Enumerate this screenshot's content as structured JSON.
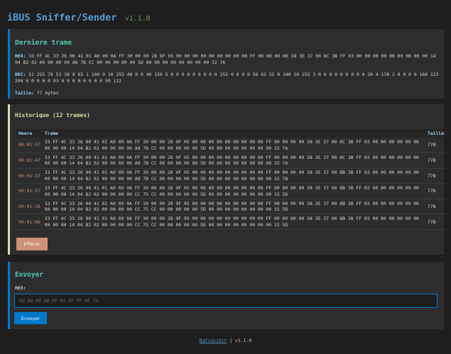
{
  "header": {
    "title": "iBUS Sniffer/Sender",
    "version": "v1.1.0"
  },
  "last_frame": {
    "title": "Derniere trame",
    "hex_label": "HEX:",
    "hex_value": "33 FF 4C 33 26 00 41 01 A0 09 0A FF 30 00 00 28 9F 05 00 00 00 00 00 00 00 00 00 FF 00 00 00 00 38 3E 37 00 8C 3B FF 03 00 00 00 00 00 00 00 00 00 14 04 B2 02 00 00 00 00 A8 7B CC 00 00 00 00 00 5D 00 00 00 00 00 00 00 00 32 7A",
    "dec_label": "DEC:",
    "dec_value": "51 255 76 51 38 0 65 1 160 9 10 255 48 0 0 40 159 5 0 0 0 0 0 0 0 0 0 255 0 0 0 0 56 62 55 0 140 59 255 3 0 0 0 0 0 0 0 0 0 20 4 178 2 0 0 0 0 168 123 204 0 0 0 0 0 93 0 0 0 0 0 0 0 0 50 122",
    "size_label": "Taille:",
    "size_value": "77 bytes"
  },
  "history": {
    "title": "Historique (12 trames)",
    "columns": [
      "Heure",
      "Trame",
      "Taille"
    ],
    "rows": [
      {
        "time": "00:01:57",
        "frame": "33 FF 4C 33 26 00 41 01 A0 09 0A FF 30 00 00 28 9F 05 00 00 00 00 00 00 00 00 00 FF 00 00 00 00 38 3E 37 00 8C 3B FF 03 00 00 00 00 00 00 00 00 00 14 04 B2 02 00 00 00 00 A8 7B CC 00 00 00 00 00 5D 00 00 00 00 00 00 00 00 32 7A",
        "size": "77B"
      },
      {
        "time": "00:01:47",
        "frame": "33 FF 4C 33 26 00 41 01 A0 09 0A FF 30 00 00 28 9F 05 00 00 00 00 00 00 00 00 00 FF 00 00 00 00 38 3E 37 00 8C 3B FF 03 00 00 00 00 00 00 00 00 00 14 04 B2 02 00 00 00 00 A8 7B CC 00 00 00 00 00 5D 00 00 00 00 00 00 00 00 32 7A",
        "size": "77B"
      },
      {
        "time": "00:01:37",
        "frame": "33 FF 4C 33 26 00 41 01 A0 09 0A FF 30 00 00 28 9F 05 00 00 00 00 00 00 00 00 00 FF 00 00 00 00 38 3E 37 00 8B 3B FF 03 00 00 00 00 00 00 00 00 00 14 04 B2 02 00 00 00 00 A8 7B CC 00 00 00 00 00 5D 00 00 00 00 00 00 00 00 32 7B",
        "size": "77B"
      },
      {
        "time": "00:01:27",
        "frame": "33 FF 4C 33 26 00 41 01 A0 09 0A FF 30 00 00 28 9F 05 00 00 00 00 00 00 00 00 00 FF 00 00 00 00 38 3E 37 00 8B 3B FF 03 00 00 00 00 00 00 00 00 00 14 04 B2 02 00 00 00 00 CC 75 CC 00 00 00 00 00 5D 00 00 00 00 00 00 00 00 32 5D",
        "size": "77B"
      },
      {
        "time": "00:01:16",
        "frame": "33 FF 4C 33 26 00 41 01 A0 09 0A FF 30 00 00 28 9F 05 00 00 00 00 00 00 00 00 00 FF 00 00 00 00 38 3E 37 00 8B 3B FF 03 00 00 00 00 00 00 00 00 00 14 04 B2 02 00 00 00 00 CC 75 CC 00 00 00 00 00 5D 00 00 00 00 00 00 00 00 32 5D",
        "size": "77B"
      },
      {
        "time": "00:01:06",
        "frame": "33 FF 4C 33 26 00 41 01 A0 09 0A FF 30 00 00 28 9F 05 00 00 00 00 00 00 00 00 00 FF 00 00 00 00 38 3E 37 00 8B 3B FF 03 00 00 00 00 00 00 00 00 00 14 04 B2 02 00 00 00 00 CC 75 CC 00 00 00 00 00 5D 00 00 00 00 00 00 00 00 32 5D",
        "size": "77B"
      }
    ],
    "clear_label": "Effacer"
  },
  "send": {
    "title": "Envoyer",
    "label": "HEX:",
    "placeholder": "FD A0 09 A0 FF 01 FF FF 9F 75",
    "value": "",
    "button_label": "Envoyer"
  },
  "footer": {
    "link_label": "Rafraichir",
    "separator": "|",
    "version": "v1.1.0"
  },
  "colors": {
    "background": "#1e1e1e",
    "card": "#2d2d2d",
    "accent_blue": "#007acc",
    "accent_yellow": "#dcdcaa",
    "title_teal": "#4ec9b0",
    "time_orange": "#ce9178",
    "key_blue": "#9cdcfe",
    "version_green": "#6a9955"
  }
}
